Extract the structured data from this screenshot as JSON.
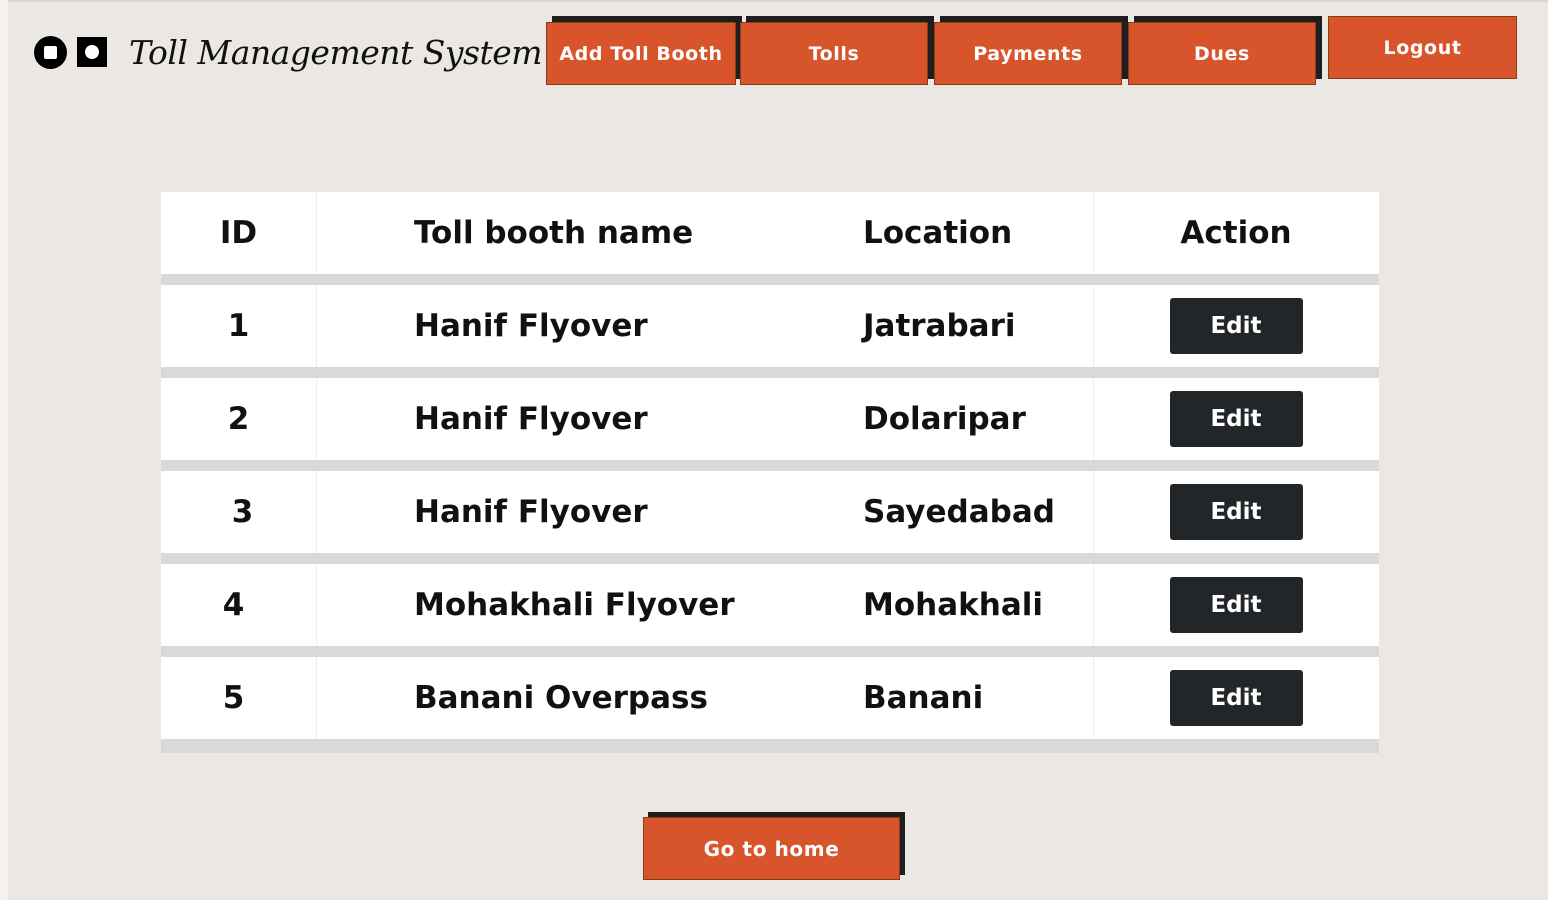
{
  "app": {
    "title": "Toll Management System",
    "logo_icon": "toggle-logo-icon"
  },
  "nav": {
    "add_toll_booth": "Add Toll Booth",
    "tolls": "Tolls",
    "payments": "Payments",
    "dues": "Dues",
    "logout": "Logout"
  },
  "table": {
    "headers": {
      "id": "ID",
      "name": "Toll booth name",
      "location": "Location",
      "action": "Action"
    },
    "rows": [
      {
        "id": "1",
        "name": "Hanif Flyover",
        "location": "Jatrabari",
        "action": "Edit"
      },
      {
        "id": "2",
        "name": "Hanif Flyover",
        "location": "Dolaripar",
        "action": "Edit"
      },
      {
        "id": "3",
        "name": "Hanif Flyover",
        "location": "Sayedabad",
        "action": "Edit"
      },
      {
        "id": "4",
        "name": "Mohakhali Flyover",
        "location": "Mohakhali",
        "action": "Edit"
      },
      {
        "id": "5",
        "name": "Banani Overpass",
        "location": "Banani",
        "action": "Edit"
      }
    ]
  },
  "footer": {
    "home_button": "Go to home"
  },
  "colors": {
    "accent": "#d8552b",
    "background": "#ebe8e4",
    "edit_button": "#232629"
  }
}
